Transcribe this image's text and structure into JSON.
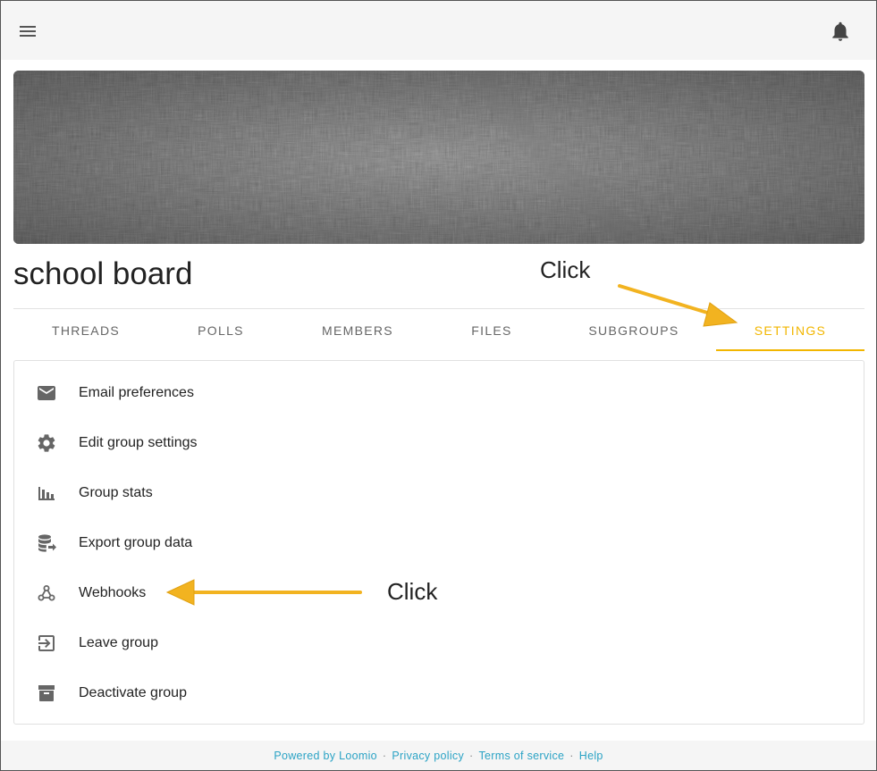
{
  "group": {
    "title": "school board"
  },
  "tabs": [
    {
      "label": "THREADS"
    },
    {
      "label": "POLLS"
    },
    {
      "label": "MEMBERS"
    },
    {
      "label": "FILES"
    },
    {
      "label": "SUBGROUPS"
    },
    {
      "label": "SETTINGS",
      "active": true
    }
  ],
  "settings_menu": [
    {
      "label": "Email preferences",
      "icon": "email-icon"
    },
    {
      "label": "Edit group settings",
      "icon": "gear-icon"
    },
    {
      "label": "Group stats",
      "icon": "bar-chart-icon"
    },
    {
      "label": "Export group data",
      "icon": "database-export-icon"
    },
    {
      "label": "Webhooks",
      "icon": "webhook-icon"
    },
    {
      "label": "Leave group",
      "icon": "exit-icon"
    },
    {
      "label": "Deactivate group",
      "icon": "archive-icon"
    }
  ],
  "footer": {
    "powered": "Powered by Loomio",
    "privacy": "Privacy policy",
    "terms": "Terms of service",
    "help": "Help",
    "separator": "·"
  },
  "annotations": {
    "click_settings": "Click",
    "click_webhooks": "Click"
  },
  "colors": {
    "accent": "#f2b600",
    "arrow": "#f2b320",
    "link": "#2ba3c5",
    "icon": "#666666"
  }
}
